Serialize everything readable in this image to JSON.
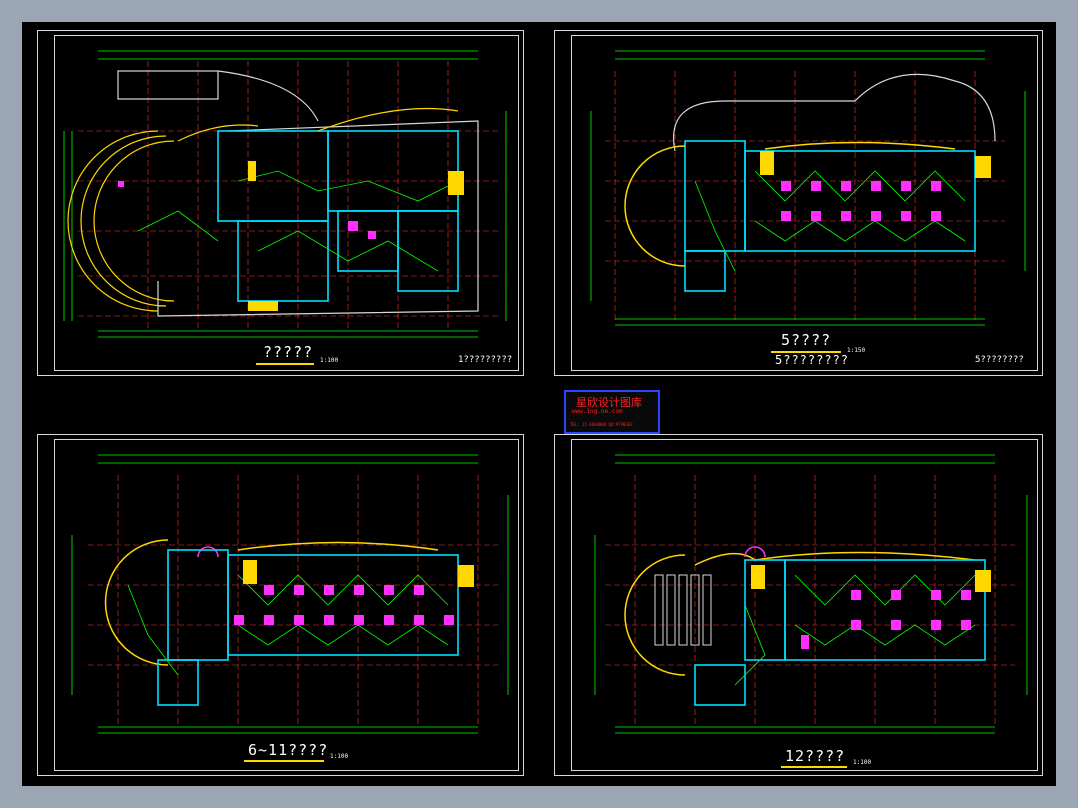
{
  "sheets": [
    {
      "title": "?????",
      "scale": "1:100",
      "corner": "1?????????"
    },
    {
      "title": "5????",
      "subtitle": "5????????",
      "scale": "1:150",
      "corner": "5????????"
    },
    {
      "title": "6~11????",
      "scale": "1:100",
      "corner": ""
    },
    {
      "title": "12????",
      "scale": "1:100",
      "corner": ""
    }
  ],
  "logo": {
    "title": "星欣设计图库",
    "line2": "www.1ng.ne.com",
    "line3": "TEL: 15 6660000 QQ:9790302"
  },
  "colors": {
    "background": "#000000",
    "border": "#d8d8d8",
    "dimension": "#00ff00",
    "axis": "#ff3030",
    "wall": "#00e0ff",
    "curve": "#ffd800",
    "fixture": "#ff30ff"
  }
}
